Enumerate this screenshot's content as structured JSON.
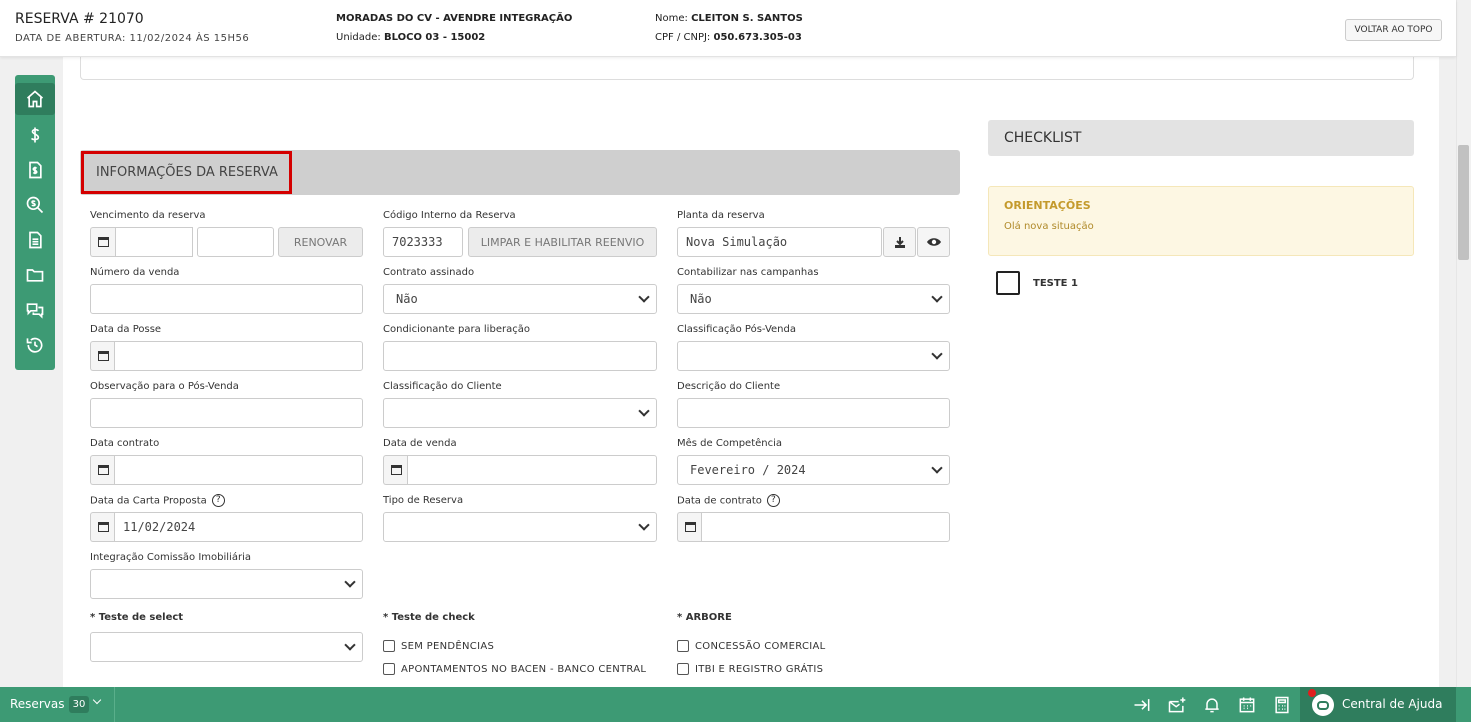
{
  "header": {
    "title": "RESERVA # 21070",
    "subtitle": "DATA DE ABERTURA: 11/02/2024 ÀS 15H56",
    "enterprise": "MORADAS DO CV - AVENDRE INTEGRAÇÃO",
    "unit_label": "Unidade:",
    "unit_value": "BLOCO 03 - 15002",
    "name_label": "Nome:",
    "name_value": "CLEITON S. SANTOS",
    "cpf_label": "CPF / CNPJ:",
    "cpf_value": "050.673.305-03",
    "back_to_top": "VOLTAR AO TOPO"
  },
  "sidebar": {
    "items": [
      "home-icon",
      "dollar-icon",
      "invoice-icon",
      "search-money-icon",
      "document-icon",
      "folder-icon",
      "chat-icon",
      "history-icon"
    ]
  },
  "section": {
    "title": "INFORMAÇÕES DA RESERVA"
  },
  "form": {
    "vencimento_label": "Vencimento da reserva",
    "renovar_label": "RENOVAR",
    "codigo_label": "Código Interno da Reserva",
    "codigo_value": "7023333",
    "limpar_label": "LIMPAR E HABILITAR REENVIO",
    "planta_label": "Planta da reserva",
    "planta_value": "Nova Simulação",
    "numero_venda_label": "Número da venda",
    "contrato_assinado_label": "Contrato assinado",
    "contrato_assinado_value": "Não",
    "contabilizar_label": "Contabilizar nas campanhas",
    "contabilizar_value": "Não",
    "data_posse_label": "Data da Posse",
    "condicionante_label": "Condicionante para liberação",
    "classificacao_pos_label": "Classificação Pós-Venda",
    "observacao_label": "Observação para o Pós-Venda",
    "classificacao_cliente_label": "Classificação do Cliente",
    "descricao_cliente_label": "Descrição do Cliente",
    "data_contrato_label": "Data contrato",
    "data_venda_label": "Data de venda",
    "mes_competencia_label": "Mês de Competência",
    "mes_competencia_value": "Fevereiro / 2024",
    "data_carta_label": "Data da Carta Proposta",
    "data_carta_value": "11/02/2024",
    "tipo_reserva_label": "Tipo de Reserva",
    "data_de_contrato_label": "Data de contrato",
    "integracao_label": "Integração Comissão Imobiliária",
    "teste_select_label": "* Teste de select",
    "teste_check_label": "* Teste de check",
    "arbore_label": "* ARBORE",
    "check_options": [
      "SEM PENDÊNCIAS",
      "APONTAMENTOS NO BACEN - BANCO CENTRAL"
    ],
    "arbore_options": [
      "CONCESSÃO COMERCIAL",
      "ITBI E REGISTRO GRÁTIS"
    ]
  },
  "checklist": {
    "title": "CHECKLIST",
    "orient_title": "ORIENTAÇÕES",
    "orient_text": "Olá nova situação",
    "item": "TESTE 1"
  },
  "footer": {
    "reservas_label": "Reservas",
    "reservas_count": "30",
    "help_label": "Central de Ajuda"
  }
}
